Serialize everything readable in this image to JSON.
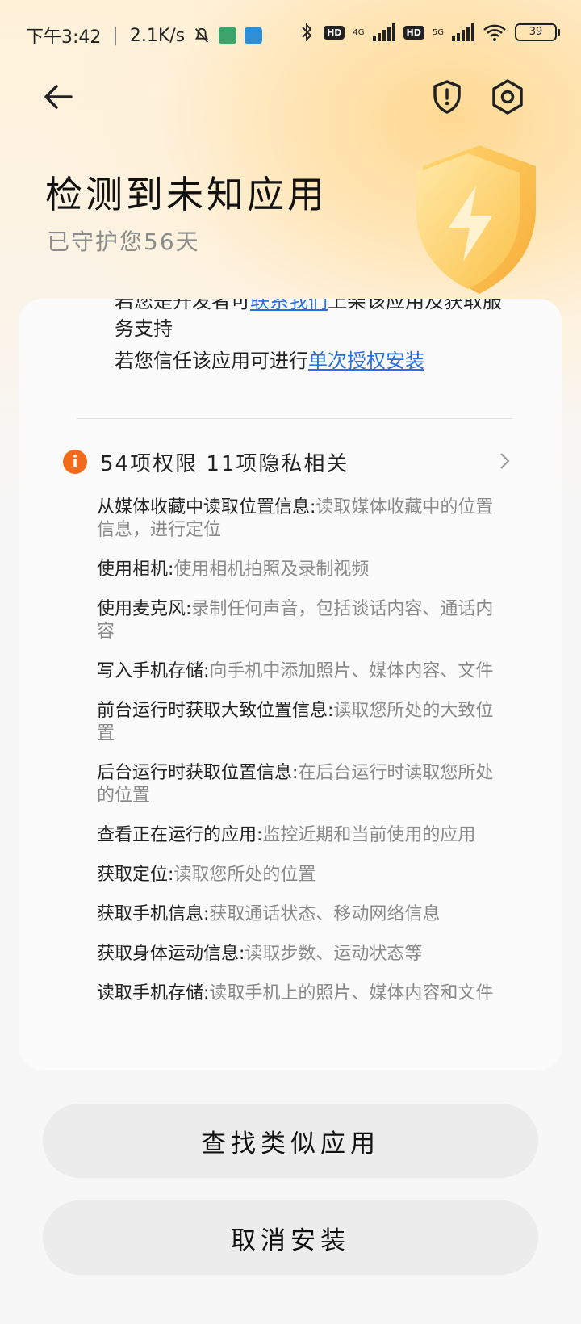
{
  "status_bar": {
    "time": "下午3:42",
    "net_speed": "2.1K/s",
    "net_4g": "4G",
    "net_5g": "5G",
    "hd": "HD",
    "battery": "39"
  },
  "header": {
    "title": "检测到未知应用",
    "subtitle": "已守护您56天"
  },
  "info": {
    "dev_prefix": "若您是开发者可",
    "dev_link": "联系我们",
    "dev_suffix": "上架该应用及获取服务支持",
    "trust_prefix": "若您信任该应用可进行",
    "trust_link": "单次授权安装"
  },
  "permissions": {
    "summary": "54项权限 11项隐私相关",
    "items": [
      {
        "name": "从媒体收藏中读取位置信息:",
        "desc": "读取媒体收藏中的位置信息，进行定位"
      },
      {
        "name": "使用相机:",
        "desc": "使用相机拍照及录制视频"
      },
      {
        "name": "使用麦克风:",
        "desc": "录制任何声音，包括谈话内容、通话内容"
      },
      {
        "name": "写入手机存储:",
        "desc": "向手机中添加照片、媒体内容、文件"
      },
      {
        "name": "前台运行时获取大致位置信息:",
        "desc": "读取您所处的大致位置"
      },
      {
        "name": "后台运行时获取位置信息:",
        "desc": "在后台运行时读取您所处的位置"
      },
      {
        "name": "查看正在运行的应用:",
        "desc": "监控近期和当前使用的应用"
      },
      {
        "name": "获取定位:",
        "desc": "读取您所处的位置"
      },
      {
        "name": "获取手机信息:",
        "desc": "获取通话状态、移动网络信息"
      },
      {
        "name": "获取身体运动信息:",
        "desc": "读取步数、运动状态等"
      },
      {
        "name": "读取手机存储:",
        "desc": "读取手机上的照片、媒体内容和文件"
      }
    ]
  },
  "buttons": {
    "find_similar": "查找类似应用",
    "cancel_install": "取消安装"
  },
  "colors": {
    "accent_orange": "#f26b1d",
    "link_blue": "#2a6fdb"
  }
}
